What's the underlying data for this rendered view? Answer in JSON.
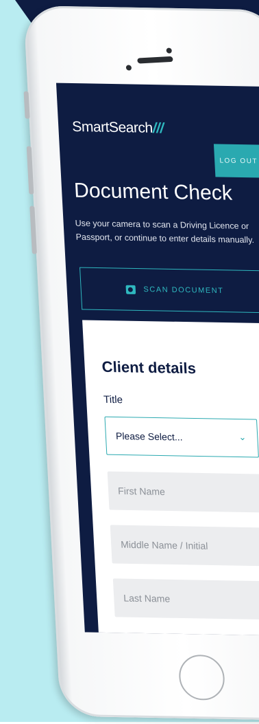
{
  "header": {
    "logo_text": "SmartSearch",
    "logo_mark": "///",
    "logout_label": "LOG OUT"
  },
  "page": {
    "title": "Document Check",
    "description": "Use your camera to scan a Driving Licence or Passport, or continue to enter details manually.",
    "scan_button_label": "SCAN DOCUMENT",
    "scan_icon": "camera-icon"
  },
  "form": {
    "heading": "Client details",
    "title_label": "Title",
    "title_select_value": "Please Select...",
    "first_name_placeholder": "First Name",
    "middle_name_placeholder": "Middle Name / Initial",
    "last_name_placeholder": "Last Name"
  },
  "colors": {
    "navy": "#0e1c42",
    "teal": "#2aa9b0",
    "cyan_background": "#b9ecf1"
  }
}
